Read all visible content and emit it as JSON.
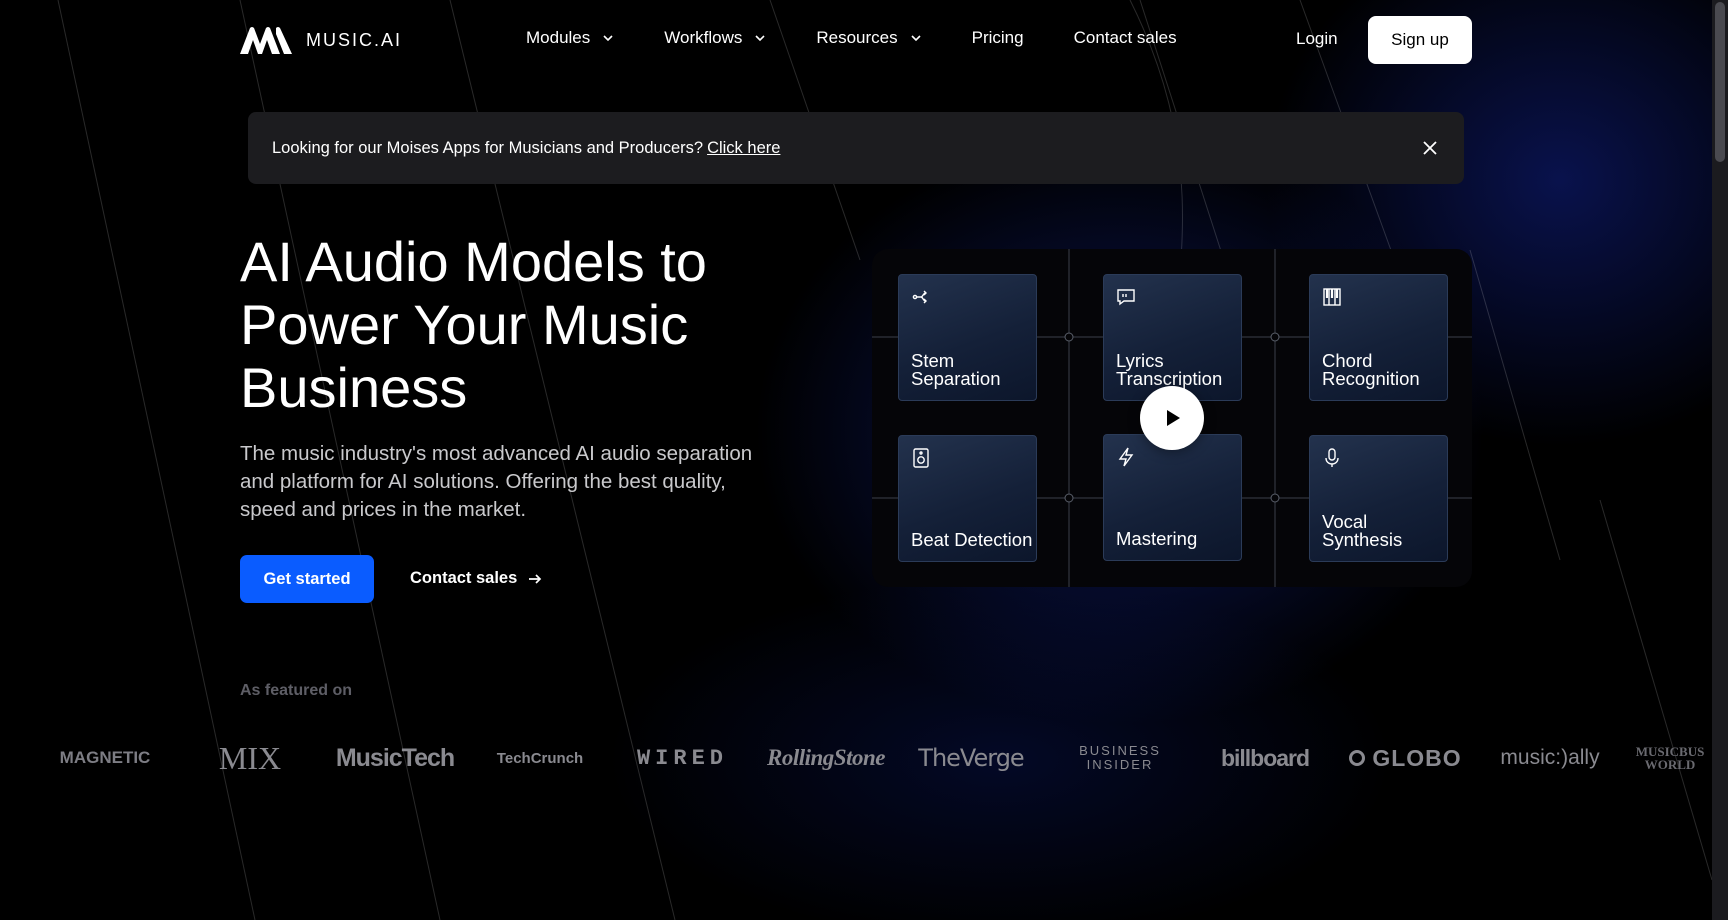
{
  "header": {
    "logo_text": "MUSIC.AI",
    "nav": [
      {
        "label": "Modules",
        "has_dropdown": true
      },
      {
        "label": "Workflows",
        "has_dropdown": true
      },
      {
        "label": "Resources",
        "has_dropdown": true
      },
      {
        "label": "Pricing",
        "has_dropdown": false
      },
      {
        "label": "Contact sales",
        "has_dropdown": false
      }
    ],
    "login_label": "Login",
    "signup_label": "Sign up"
  },
  "banner": {
    "text": "Looking for our Moises Apps for Musicians and Producers?",
    "link_label": "Click here",
    "close_icon": "close-icon"
  },
  "hero": {
    "title": "AI Audio Models to Power Your Music Business",
    "subtitle": "The music industry's most advanced AI audio separation and platform for AI solutions. Offering the best quality, speed and prices in the market.",
    "cta_primary": "Get started",
    "cta_secondary": "Contact sales"
  },
  "modules": [
    {
      "label": "Stem Separation",
      "icon": "share-icon"
    },
    {
      "label": "Lyrics Transcription",
      "icon": "quote-bubble-icon"
    },
    {
      "label": "Chord Recognition",
      "icon": "piano-keys-icon"
    },
    {
      "label": "Beat Detection",
      "icon": "speaker-icon"
    },
    {
      "label": "Mastering",
      "icon": "lightning-icon"
    },
    {
      "label": "Vocal Synthesis",
      "icon": "microphone-icon"
    }
  ],
  "featured": {
    "label": "As featured on",
    "logos": [
      "MAGNETIC",
      "MIX",
      "MusicTech",
      "TechCrunch",
      "WIRED",
      "RollingStone",
      "TheVerge",
      "BUSINESS INSIDER",
      "billboard",
      "GLOBO",
      "music:)ally",
      "MUSICBUS WORLD"
    ]
  },
  "colors": {
    "background": "#000000",
    "accent": "#0a5cff",
    "banner_bg": "#1c1c1f",
    "card_bg": "#142038",
    "muted_text": "#5e5e66"
  }
}
